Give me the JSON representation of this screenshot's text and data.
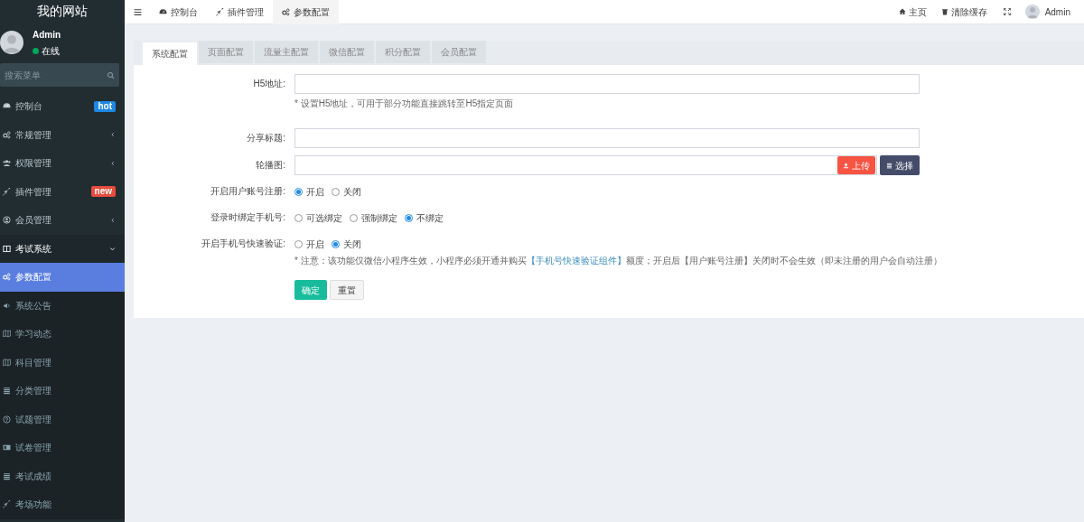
{
  "sidebar": {
    "site_title": "我的网站",
    "user": {
      "name": "Admin",
      "status": "在线"
    },
    "search": {
      "placeholder": "搜索菜单"
    },
    "items": [
      {
        "label": "控制台",
        "badge": {
          "text": "hot",
          "color": "#1e88e5"
        },
        "selected": false
      },
      {
        "label": "常规管理",
        "expanded": false,
        "selected": false
      },
      {
        "label": "权限管理",
        "expanded": false,
        "selected": false
      },
      {
        "label": "插件管理",
        "badge": {
          "text": "new",
          "color": "#e74c3c"
        },
        "selected": false
      },
      {
        "label": "会员管理",
        "expanded": false,
        "selected": false
      },
      {
        "label": "考试系统",
        "expanded": true,
        "selected": false,
        "children": [
          {
            "label": "参数配置",
            "selected": true
          },
          {
            "label": "系统公告",
            "selected": false
          },
          {
            "label": "学习动态",
            "selected": false
          },
          {
            "label": "科目管理",
            "selected": false
          },
          {
            "label": "分类管理",
            "selected": false
          },
          {
            "label": "试题管理",
            "selected": false
          },
          {
            "label": "试卷管理",
            "selected": false
          },
          {
            "label": "考试成绩",
            "selected": false
          },
          {
            "label": "考场功能",
            "selected": false
          }
        ]
      }
    ]
  },
  "topbar": {
    "tabs": [
      {
        "label": "控制台",
        "selected": false
      },
      {
        "label": "插件管理",
        "selected": false
      },
      {
        "label": "参数配置",
        "selected": true
      }
    ],
    "right": [
      {
        "label": "主页"
      },
      {
        "label": "清除缓存"
      }
    ],
    "user": "Admin"
  },
  "config_tabs": [
    {
      "label": "系统配置",
      "selected": true
    },
    {
      "label": "页面配置",
      "selected": false
    },
    {
      "label": "流量主配置",
      "selected": false
    },
    {
      "label": "微信配置",
      "selected": false
    },
    {
      "label": "积分配置",
      "selected": false
    },
    {
      "label": "会员配置",
      "selected": false
    }
  ],
  "form": [
    {
      "kind": "text",
      "label": "H5地址:",
      "help": "* 设置H5地址，可用于部分功能直接跳转至H5指定页面"
    },
    {
      "kind": "text",
      "label": "分享标题:"
    },
    {
      "kind": "upload",
      "label": "轮播图:",
      "upload": "上传",
      "choose": "选择"
    },
    {
      "kind": "radio",
      "label": "开启用户账号注册:",
      "options": [
        {
          "label": "开启",
          "selected": true
        },
        {
          "label": "关闭",
          "selected": false
        }
      ]
    },
    {
      "kind": "radio",
      "label": "登录时绑定手机号:",
      "options": [
        {
          "label": "可选绑定",
          "selected": false
        },
        {
          "label": "强制绑定",
          "selected": false
        },
        {
          "label": "不绑定",
          "selected": true
        }
      ]
    },
    {
      "kind": "radio",
      "label": "开启手机号快速验证:",
      "options": [
        {
          "label": "开启",
          "selected": false
        },
        {
          "label": "关闭",
          "selected": true
        }
      ],
      "notice": {
        "before": "* 注意：该功能仅微信小程序生效，小程序必须开通并购买",
        "link": "【手机号快速验证组件】",
        "after": "额度；开启后【用户账号注册】关闭时不会生效（即未注册的用户会自动注册）"
      }
    }
  ],
  "buttons": {
    "submit": "确定",
    "reset": "重置"
  }
}
